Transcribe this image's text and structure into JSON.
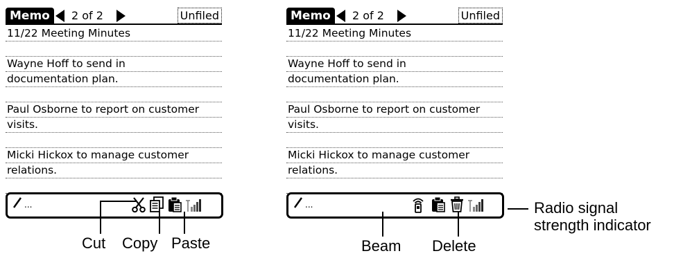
{
  "screens": [
    {
      "app_label": "Memo",
      "record_counter": "2 of 2",
      "category": "Unfiled",
      "lines": [
        "11/22 Meeting Minutes",
        "",
        "Wayne Hoff to send in",
        "documentation plan.",
        "",
        "Paul Osborne to report on customer",
        "visits.",
        "",
        "Micki Hickox to manage customer",
        "relations.",
        ""
      ],
      "toolbar_icons": [
        "cut-icon",
        "copy-icon",
        "paste-icon",
        "signal-strength-icon"
      ]
    },
    {
      "app_label": "Memo",
      "record_counter": "2 of 2",
      "category": "Unfiled",
      "lines": [
        "11/22 Meeting Minutes",
        "",
        "Wayne Hoff to send in",
        "documentation plan.",
        "",
        "Paul Osborne to report on customer",
        "visits.",
        "",
        "Micki Hickox to manage customer",
        "relations.",
        ""
      ],
      "toolbar_icons": [
        "beam-icon",
        "paste-icon",
        "delete-icon",
        "signal-strength-icon"
      ]
    }
  ],
  "command_bar": {
    "ellipsis": "..."
  },
  "callouts": {
    "cut": "Cut",
    "copy": "Copy",
    "paste": "Paste",
    "beam": "Beam",
    "delete": "Delete",
    "signal_line1": "Radio signal",
    "signal_line2": "strength indicator"
  }
}
